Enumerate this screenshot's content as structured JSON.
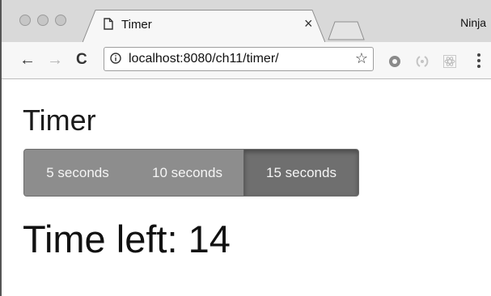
{
  "browser": {
    "tab_title": "Timer",
    "tab_close": "×",
    "profile_label": "Ninja",
    "url": "localhost:8080/ch11/timer/"
  },
  "toolbar": {
    "back_icon": "←",
    "forward_icon": "→",
    "reload_icon": "C",
    "star_icon": "☆"
  },
  "page": {
    "title": "Timer",
    "buttons": [
      {
        "label": "5 seconds",
        "active": false
      },
      {
        "label": "10 seconds",
        "active": false
      },
      {
        "label": "15 seconds",
        "active": true
      }
    ],
    "time_left": "Time left: 14"
  },
  "colors": {
    "button_bg": "#8d8d8d",
    "button_active_bg": "#6f6f6f",
    "tabstrip_bg": "#d9d9d9",
    "toolbar_bg": "#f7f7f7"
  }
}
